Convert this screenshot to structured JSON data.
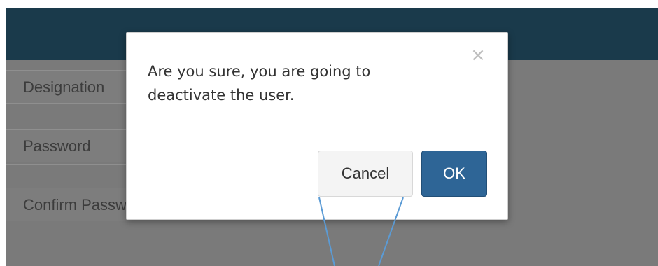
{
  "form": {
    "rows": [
      {
        "label": "Designation"
      },
      {
        "label": "Password"
      },
      {
        "label": "Confirm Password"
      }
    ]
  },
  "dialog": {
    "message": "Are you sure, you are going to deactivate the user.",
    "close_glyph": "×",
    "cancel_label": "Cancel",
    "ok_label": "OK"
  },
  "colors": {
    "header": "#1a3a4b",
    "overlay": "#7a7a7a",
    "ok_button": "#2e6596",
    "callout_line": "#5b9bd5"
  },
  "icons": {
    "close": "close-icon"
  }
}
